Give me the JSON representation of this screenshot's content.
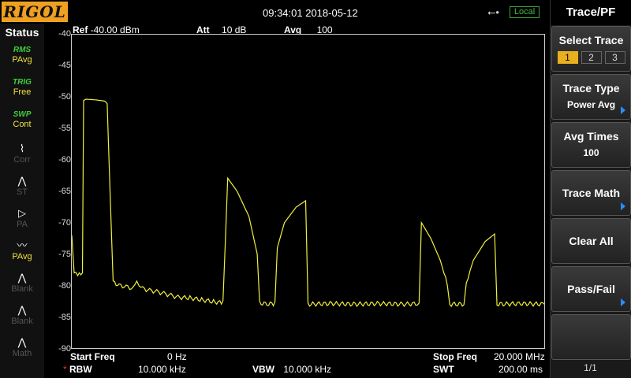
{
  "header": {
    "logo": "RIGOL",
    "datetime": "09:34:01 2018-05-12",
    "usb_icon": "usb-icon",
    "local": "Local"
  },
  "status": {
    "title": "Status",
    "items": [
      {
        "top": "RMS",
        "bottom": "PAvg",
        "on": true
      },
      {
        "top": "TRIG",
        "bottom": "Free",
        "on": true
      },
      {
        "top": "SWP",
        "bottom": "Cont",
        "on": true
      },
      {
        "top": "",
        "bottom": "Corr",
        "on": false
      },
      {
        "top": "",
        "bottom": "ST",
        "on": false
      },
      {
        "top": "",
        "bottom": "PA",
        "on": false
      },
      {
        "top": "",
        "bottom": "PAvg",
        "on": true
      },
      {
        "top": "",
        "bottom": "Blank",
        "on": false
      },
      {
        "top": "",
        "bottom": "Blank",
        "on": false
      },
      {
        "top": "",
        "bottom": "Math",
        "on": false
      }
    ]
  },
  "graph_header": {
    "ref_label": "Ref",
    "ref_value": "-40.00 dBm",
    "att_label": "Att",
    "att_value": "10 dB",
    "avg_label": "Avg",
    "avg_value": "100"
  },
  "footer": {
    "start_label": "Start Freq",
    "start_value": "0 Hz",
    "stop_label": "Stop Freq",
    "stop_value": "20.000 MHz",
    "rbw_mark": "*",
    "rbw_label": "RBW",
    "rbw_value": "10.000 kHz",
    "vbw_label": "VBW",
    "vbw_value": "10.000 kHz",
    "swt_label": "SWT",
    "swt_value": "200.00 ms"
  },
  "panel": {
    "title": "Trace/PF",
    "select_trace": {
      "label": "Select Trace",
      "options": [
        "1",
        "2",
        "3"
      ],
      "active": 0
    },
    "trace_type": {
      "label": "Trace Type",
      "value": "Power Avg"
    },
    "avg_times": {
      "label": "Avg Times",
      "value": "100"
    },
    "trace_math": {
      "label": "Trace Math"
    },
    "clear_all": {
      "label": "Clear All"
    },
    "pass_fail": {
      "label": "Pass/Fail"
    },
    "page": "1/1"
  },
  "colors": {
    "trace": "#f0f040",
    "logo": "#f0a020",
    "accent": "#2b8cff"
  },
  "chart_data": {
    "type": "line",
    "title": "",
    "xlabel": "",
    "ylabel": "",
    "y_ticks": [
      "-40",
      "-45",
      "-50",
      "-55",
      "-60",
      "-65",
      "-70",
      "-75",
      "-80",
      "-85",
      "-90"
    ],
    "xlim": [
      0,
      20
    ],
    "ylim": [
      -90,
      -40
    ],
    "x_unit": "MHz",
    "y_unit": "dBm",
    "grid": false,
    "series": [
      {
        "points": [
          [
            0.0,
            -72.0
          ],
          [
            0.1,
            -78.0
          ],
          [
            0.25,
            -78.5
          ],
          [
            0.45,
            -78.0
          ],
          [
            0.5,
            -50.5
          ],
          [
            0.6,
            -50.3
          ],
          [
            1.0,
            -50.4
          ],
          [
            1.4,
            -50.6
          ],
          [
            1.5,
            -51.0
          ],
          [
            1.55,
            -57.0
          ],
          [
            1.75,
            -79.5
          ],
          [
            2.0,
            -80.0
          ],
          [
            2.3,
            -80.2
          ],
          [
            2.6,
            -80.5
          ],
          [
            2.75,
            -79.6
          ],
          [
            2.85,
            -80.4
          ],
          [
            3.0,
            -80.5
          ],
          [
            3.3,
            -80.8
          ],
          [
            3.6,
            -81.0
          ],
          [
            3.9,
            -81.3
          ],
          [
            4.2,
            -81.6
          ],
          [
            4.5,
            -81.9
          ],
          [
            5.0,
            -82.0
          ],
          [
            5.5,
            -82.3
          ],
          [
            6.0,
            -82.6
          ],
          [
            6.4,
            -82.8
          ],
          [
            6.5,
            -73.0
          ],
          [
            6.6,
            -62.9
          ],
          [
            7.0,
            -65.0
          ],
          [
            7.5,
            -69.0
          ],
          [
            7.85,
            -75.0
          ],
          [
            7.95,
            -82.8
          ],
          [
            8.2,
            -83.0
          ],
          [
            8.6,
            -82.9
          ],
          [
            8.7,
            -74.0
          ],
          [
            9.0,
            -70.0
          ],
          [
            9.5,
            -67.5
          ],
          [
            9.9,
            -66.5
          ],
          [
            10.0,
            -83.0
          ],
          [
            11.0,
            -82.9
          ],
          [
            12.0,
            -83.0
          ],
          [
            13.0,
            -82.9
          ],
          [
            14.0,
            -83.0
          ],
          [
            14.7,
            -82.9
          ],
          [
            14.8,
            -70.0
          ],
          [
            15.2,
            -72.5
          ],
          [
            15.6,
            -76.0
          ],
          [
            15.9,
            -80.0
          ],
          [
            16.0,
            -83.0
          ],
          [
            16.6,
            -83.0
          ],
          [
            16.7,
            -79.5
          ],
          [
            17.0,
            -76.0
          ],
          [
            17.5,
            -73.0
          ],
          [
            17.9,
            -71.8
          ],
          [
            18.0,
            -83.0
          ],
          [
            19.0,
            -82.9
          ],
          [
            20.0,
            -83.0
          ]
        ]
      }
    ]
  }
}
